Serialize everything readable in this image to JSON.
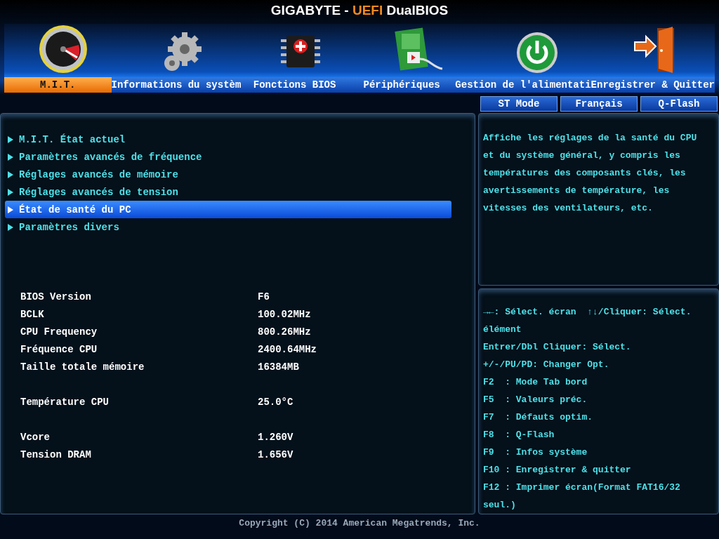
{
  "title": {
    "brand": "GIGABYTE - ",
    "accent": "UEFI",
    "product": " DualBIOS"
  },
  "tabs": [
    {
      "label": "M.I.T.",
      "selected": true
    },
    {
      "label": "Informations du systèm",
      "selected": false
    },
    {
      "label": "Fonctions BIOS",
      "selected": false
    },
    {
      "label": "Périphériques",
      "selected": false
    },
    {
      "label": "Gestion de l'alimentati",
      "selected": false
    },
    {
      "label": "Enregistrer & Quitter",
      "selected": false
    }
  ],
  "mode_buttons": [
    "ST Mode",
    "Français",
    "Q-Flash"
  ],
  "menu": [
    {
      "label": "M.I.T. État actuel",
      "selected": false
    },
    {
      "label": "Paramètres avancés de fréquence",
      "selected": false
    },
    {
      "label": "Réglages avancés de mémoire",
      "selected": false
    },
    {
      "label": "Réglages avancés de tension",
      "selected": false
    },
    {
      "label": "État de santé du PC",
      "selected": true
    },
    {
      "label": "Paramètres divers",
      "selected": false
    }
  ],
  "info_groups": [
    [
      {
        "label": "BIOS Version",
        "value": "F6"
      },
      {
        "label": "BCLK",
        "value": "100.02MHz"
      },
      {
        "label": "CPU Frequency",
        "value": "800.26MHz"
      },
      {
        "label": "Fréquence CPU",
        "value": "2400.64MHz"
      },
      {
        "label": "Taille totale mémoire",
        "value": "16384MB"
      }
    ],
    [
      {
        "label": "Température CPU",
        "value": "25.0°C"
      }
    ],
    [
      {
        "label": "Vcore",
        "value": "1.260V"
      },
      {
        "label": "Tension DRAM",
        "value": "1.656V"
      }
    ]
  ],
  "description": "Affiche les réglages de la santé du CPU et du système général, y compris les températures des composants clés, les avertissements de température, les vitesses des ventilateurs, etc.",
  "help": [
    "→←: Sélect. écran  ↑↓/Cliquer: Sélect. élément",
    "Entrer/Dbl Cliquer: Sélect.",
    "+/-/PU/PD: Changer Opt.",
    "F2  : Mode Tab bord",
    "F5  : Valeurs préc.",
    "F7  : Défauts optim.",
    "F8  : Q-Flash",
    "F9  : Infos système",
    "F10 : Enregistrer & quitter",
    "F12 : Imprimer écran(Format FAT16/32 seul.)"
  ],
  "copyright": "Copyright (C) 2014 American Megatrends, Inc."
}
